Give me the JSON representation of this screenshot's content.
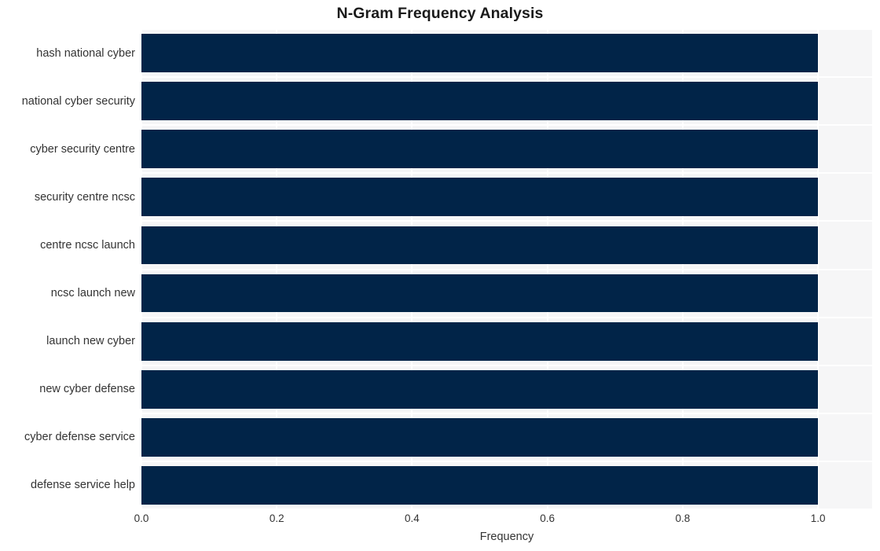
{
  "chart_data": {
    "type": "bar",
    "orientation": "horizontal",
    "title": "N-Gram Frequency Analysis",
    "xlabel": "Frequency",
    "ylabel": "",
    "categories": [
      "hash national cyber",
      "national cyber security",
      "cyber security centre",
      "security centre ncsc",
      "centre ncsc launch",
      "ncsc launch new",
      "launch new cyber",
      "new cyber defense",
      "cyber defense service",
      "defense service help"
    ],
    "values": [
      1.0,
      1.0,
      1.0,
      1.0,
      1.0,
      1.0,
      1.0,
      1.0,
      1.0,
      1.0
    ],
    "xlim": [
      0.0,
      1.08
    ],
    "xticks": [
      0.0,
      0.2,
      0.4,
      0.6,
      0.8,
      1.0
    ],
    "xtick_labels": [
      "0.0",
      "0.2",
      "0.4",
      "0.6",
      "0.8",
      "1.0"
    ],
    "grid": true,
    "legend": false,
    "bar_color": "#012448",
    "plot_background": "#f6f6f7",
    "grid_color": "#ffffff",
    "figure_background": "#ffffff",
    "text_color": "#333333",
    "title_color": "#1a1a1a"
  }
}
